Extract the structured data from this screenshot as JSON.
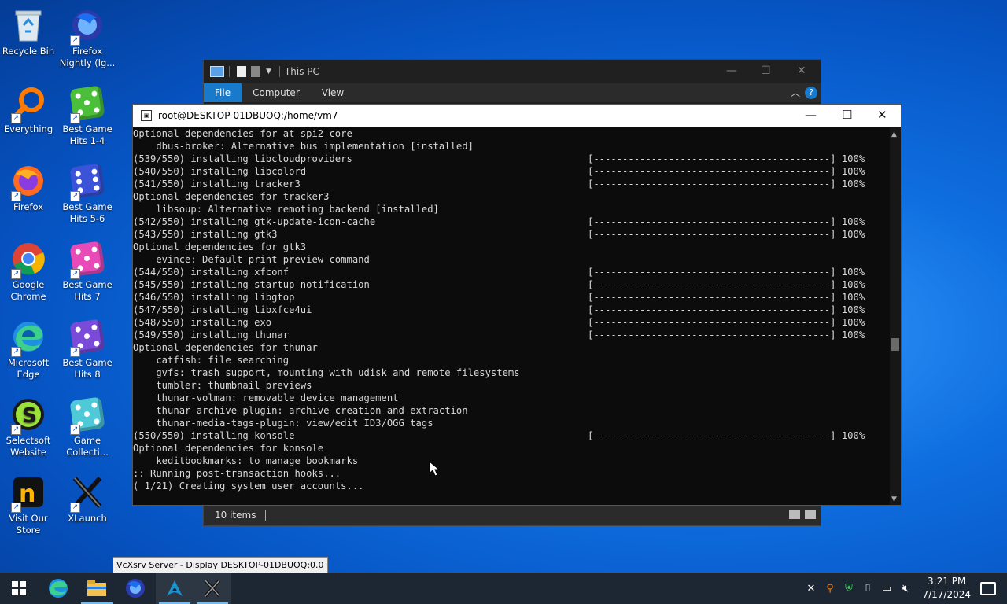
{
  "desktop": {
    "icons": [
      {
        "label": "Recycle Bin",
        "icon": "recycle-bin-icon"
      },
      {
        "label": "Firefox Nightly (lg...",
        "icon": "firefox-nightly-icon"
      },
      {
        "label": "Everything",
        "icon": "everything-search-icon"
      },
      {
        "label": "Best Game Hits 1-4",
        "icon": "dice-icon"
      },
      {
        "label": "Firefox",
        "icon": "firefox-icon"
      },
      {
        "label": "Best Game Hits 5-6",
        "icon": "dice-icon"
      },
      {
        "label": "Google Chrome",
        "icon": "chrome-icon"
      },
      {
        "label": "Best Game Hits 7",
        "icon": "dice-icon"
      },
      {
        "label": "Microsoft Edge",
        "icon": "edge-icon"
      },
      {
        "label": "Best Game Hits 8",
        "icon": "dice-icon"
      },
      {
        "label": "Selectsoft Website",
        "icon": "selectsoft-icon"
      },
      {
        "label": "Game Collecti...",
        "icon": "dice-icon"
      },
      {
        "label": "Visit Our Store",
        "icon": "store-icon"
      },
      {
        "label": "XLaunch",
        "icon": "xlaunch-icon"
      }
    ]
  },
  "explorer": {
    "title": "This PC",
    "tabs": [
      "File",
      "Computer",
      "View"
    ],
    "status": "10 items"
  },
  "terminal": {
    "title": "root@DESKTOP-01DBUOQ:/home/vm7",
    "lines": [
      {
        "text": "Optional dependencies for at-spi2-core",
        "progress": ""
      },
      {
        "text": "    dbus-broker: Alternative bus implementation [installed]",
        "progress": ""
      },
      {
        "text": "(539/550) installing libcloudproviders",
        "progress": "[-----------------------------------------] 100%"
      },
      {
        "text": "(540/550) installing libcolord",
        "progress": "[-----------------------------------------] 100%"
      },
      {
        "text": "(541/550) installing tracker3",
        "progress": "[-----------------------------------------] 100%"
      },
      {
        "text": "Optional dependencies for tracker3",
        "progress": ""
      },
      {
        "text": "    libsoup: Alternative remoting backend [installed]",
        "progress": ""
      },
      {
        "text": "(542/550) installing gtk-update-icon-cache",
        "progress": "[-----------------------------------------] 100%"
      },
      {
        "text": "(543/550) installing gtk3",
        "progress": "[-----------------------------------------] 100%"
      },
      {
        "text": "Optional dependencies for gtk3",
        "progress": ""
      },
      {
        "text": "    evince: Default print preview command",
        "progress": ""
      },
      {
        "text": "(544/550) installing xfconf",
        "progress": "[-----------------------------------------] 100%"
      },
      {
        "text": "(545/550) installing startup-notification",
        "progress": "[-----------------------------------------] 100%"
      },
      {
        "text": "(546/550) installing libgtop",
        "progress": "[-----------------------------------------] 100%"
      },
      {
        "text": "(547/550) installing libxfce4ui",
        "progress": "[-----------------------------------------] 100%"
      },
      {
        "text": "(548/550) installing exo",
        "progress": "[-----------------------------------------] 100%"
      },
      {
        "text": "(549/550) installing thunar",
        "progress": "[-----------------------------------------] 100%"
      },
      {
        "text": "Optional dependencies for thunar",
        "progress": ""
      },
      {
        "text": "    catfish: file searching",
        "progress": ""
      },
      {
        "text": "    gvfs: trash support, mounting with udisk and remote filesystems",
        "progress": ""
      },
      {
        "text": "    tumbler: thumbnail previews",
        "progress": ""
      },
      {
        "text": "    thunar-volman: removable device management",
        "progress": ""
      },
      {
        "text": "    thunar-archive-plugin: archive creation and extraction",
        "progress": ""
      },
      {
        "text": "    thunar-media-tags-plugin: view/edit ID3/OGG tags",
        "progress": ""
      },
      {
        "text": "(550/550) installing konsole",
        "progress": "[-----------------------------------------] 100%"
      },
      {
        "text": "Optional dependencies for konsole",
        "progress": ""
      },
      {
        "text": "    keditbookmarks: to manage bookmarks",
        "progress": ""
      },
      {
        "text": ":: Running post-transaction hooks...",
        "progress": ""
      },
      {
        "text": "( 1/21) Creating system user accounts...",
        "progress": ""
      }
    ]
  },
  "tooltip": "VcXsrv Server - Display DESKTOP-01DBUOQ:0.0",
  "taskbar": {
    "items": [
      "start-icon",
      "edge-icon",
      "file-explorer-icon",
      "firefox-icon",
      "arch-icon",
      "xlaunch-icon"
    ],
    "clock": {
      "time": "3:21 PM",
      "date": "7/17/2024"
    }
  },
  "colors": {
    "terminal_bg": "#0c0c0c",
    "accent": "#1979ca",
    "taskbar": "#1c2733"
  }
}
